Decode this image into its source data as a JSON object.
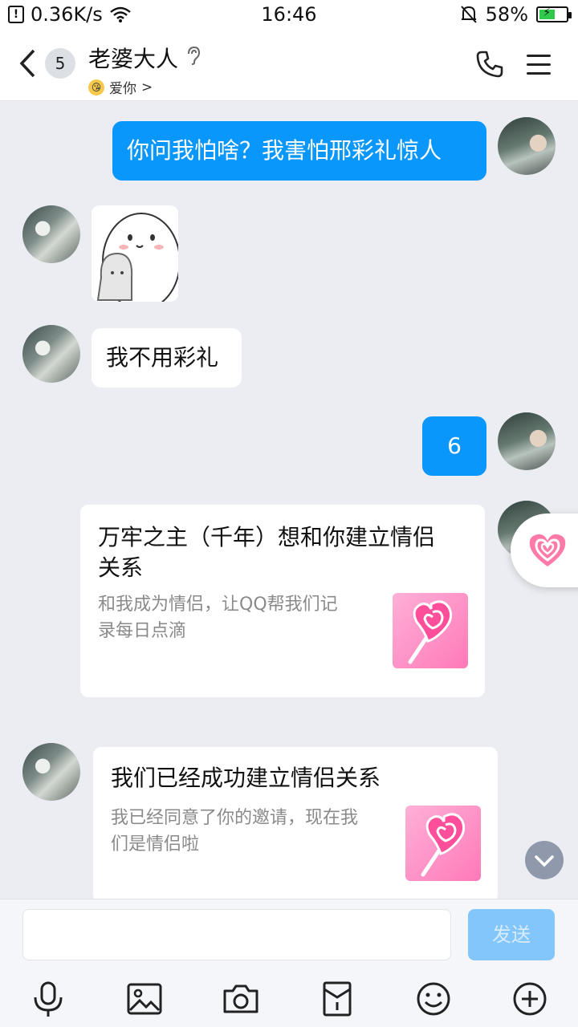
{
  "status_bar": {
    "network_speed": "0.36K/s",
    "time": "16:46",
    "battery": "58%",
    "battery_level": 0.58
  },
  "header": {
    "back_icon": "chevron-left-icon",
    "unread_count": "5",
    "contact_name": "老婆大人",
    "subtitle": "爱你",
    "subtitle_chevron": ">"
  },
  "messages": {
    "m1": "你问我怕啥？我害怕邢彩礼惊人",
    "m3": "我不用彩礼",
    "m4": "6",
    "card1": {
      "title_line1": "万牢之主（千年）想和你建立情侣",
      "title_line2": "关系",
      "desc_line1": "和我成为情侣，让QQ帮我们记",
      "desc_line2": "录每日点滴"
    },
    "card2": {
      "title": "我们已经成功建立情侣关系",
      "desc_line1": "我已经同意了你的邀请，现在我",
      "desc_line2": "们是情侣啦"
    }
  },
  "input": {
    "value": "",
    "send_label": "发送"
  },
  "toolbar": [
    "microphone-icon",
    "image-icon",
    "camera-icon",
    "red-packet-icon",
    "emoji-icon",
    "plus-icon"
  ],
  "colors": {
    "outgoing_bubble": "#0a97fb",
    "send_button": "#83c6fb",
    "background": "#ebedf2"
  }
}
